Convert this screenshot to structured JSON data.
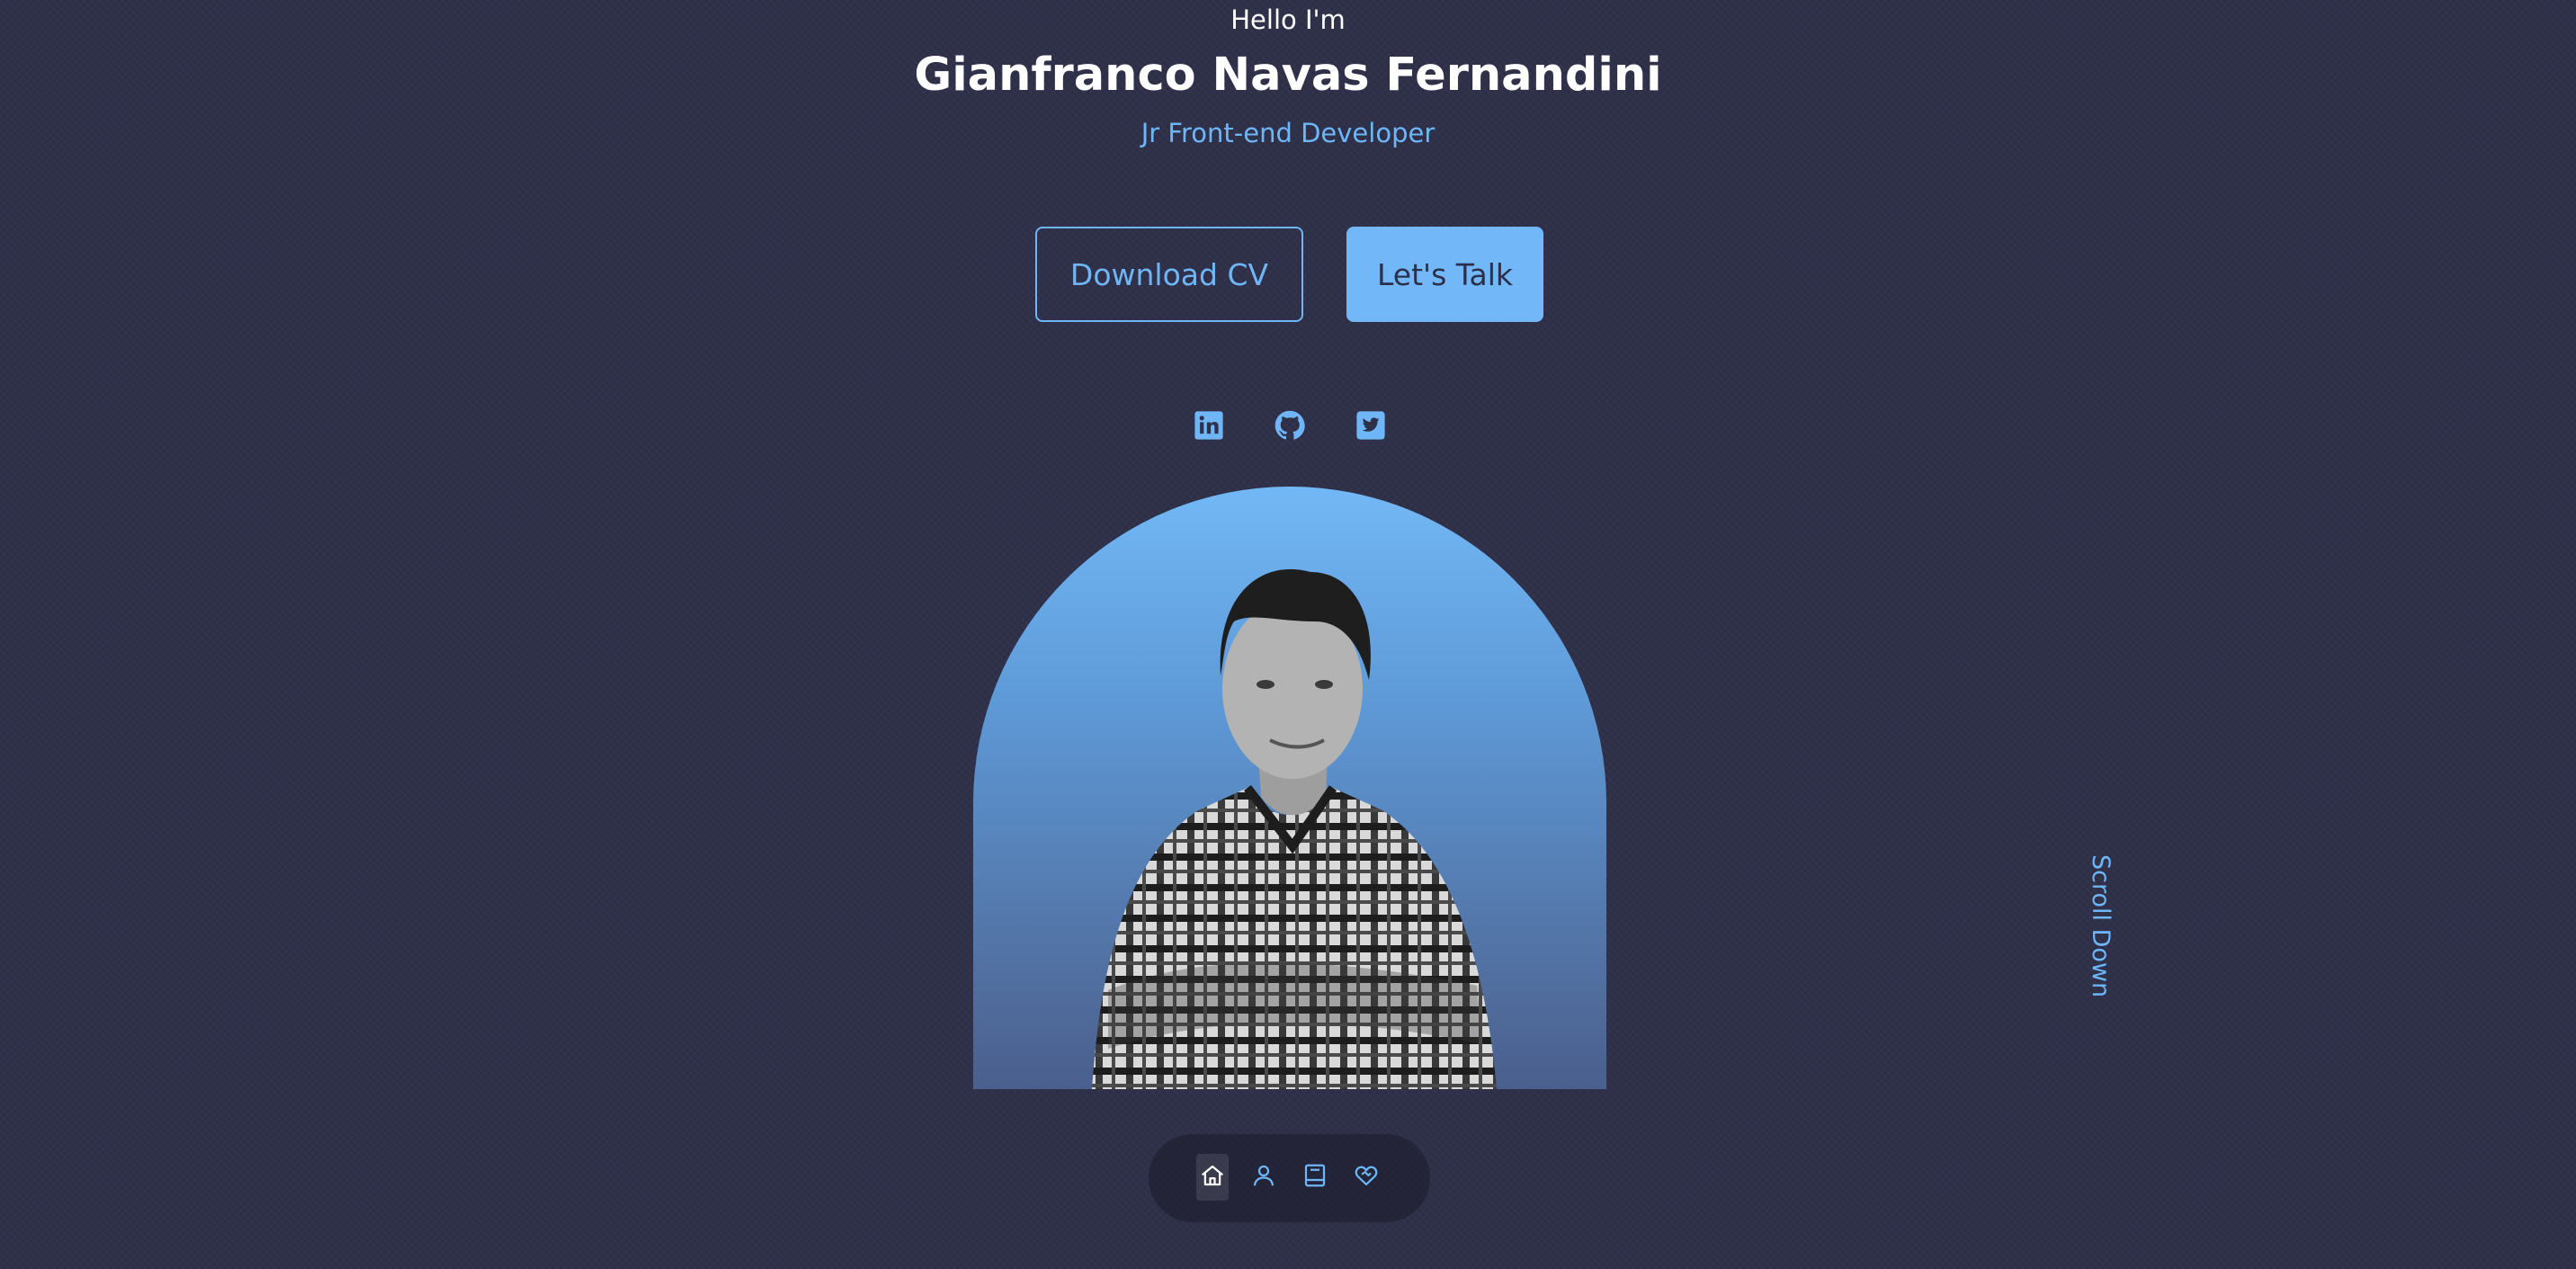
{
  "header": {
    "greeting": "Hello I'm",
    "name": "Gianfranco Navas Fernandini",
    "role": "Jr Front-end Developer"
  },
  "actions": {
    "download_cv_label": "Download CV",
    "lets_talk_label": "Let's Talk"
  },
  "social": [
    {
      "icon": "linkedin-icon"
    },
    {
      "icon": "github-icon"
    },
    {
      "icon": "twitter-icon"
    }
  ],
  "scroll": {
    "label": "Scroll Down"
  },
  "nav": {
    "items": [
      {
        "icon": "home-icon",
        "active": true
      },
      {
        "icon": "user-icon",
        "active": false
      },
      {
        "icon": "book-icon",
        "active": false
      },
      {
        "icon": "heart-handshake-icon",
        "active": false
      }
    ]
  },
  "colors": {
    "background": "#2f3049",
    "accent": "#6eb6f8",
    "text": "#ffffff",
    "button_dark_text": "#2c2f4a"
  }
}
